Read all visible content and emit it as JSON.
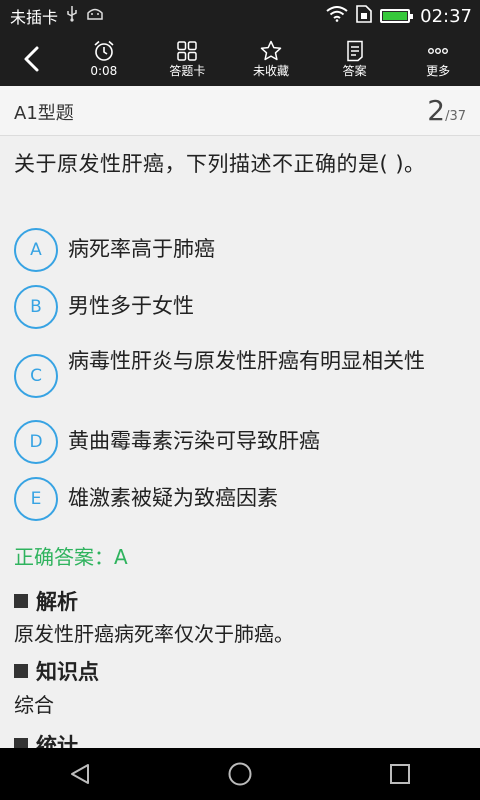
{
  "status_bar": {
    "carrier": "未插卡",
    "time": "02:37"
  },
  "toolbar": {
    "timer_label": "0:08",
    "card_label": "答题卡",
    "favorite_label": "未收藏",
    "answer_label": "答案",
    "more_label": "更多"
  },
  "header": {
    "question_type": "A1型题",
    "current": "2",
    "total": "/37"
  },
  "question": {
    "text": "关于原发性肝癌，下列描述不正确的是(    )。",
    "options": [
      {
        "letter": "A",
        "text": "病死率高于肺癌"
      },
      {
        "letter": "B",
        "text": "男性多于女性"
      },
      {
        "letter": "C",
        "text": "病毒性肝炎与原发性肝癌有明显相关性"
      },
      {
        "letter": "D",
        "text": "黄曲霉毒素污染可导致肝癌"
      },
      {
        "letter": "E",
        "text": "雄激素被疑为致癌因素"
      }
    ],
    "correct_answer": "正确答案：A"
  },
  "analysis": {
    "title": "解析",
    "body": "原发性肝癌病死率仅次于肺癌。"
  },
  "knowledge": {
    "title": "知识点",
    "body": "综合"
  },
  "stats": {
    "title": "统计"
  },
  "colors": {
    "accent": "#37a3e3",
    "correct": "#2fb35e",
    "bar": "#1e1e1e"
  }
}
